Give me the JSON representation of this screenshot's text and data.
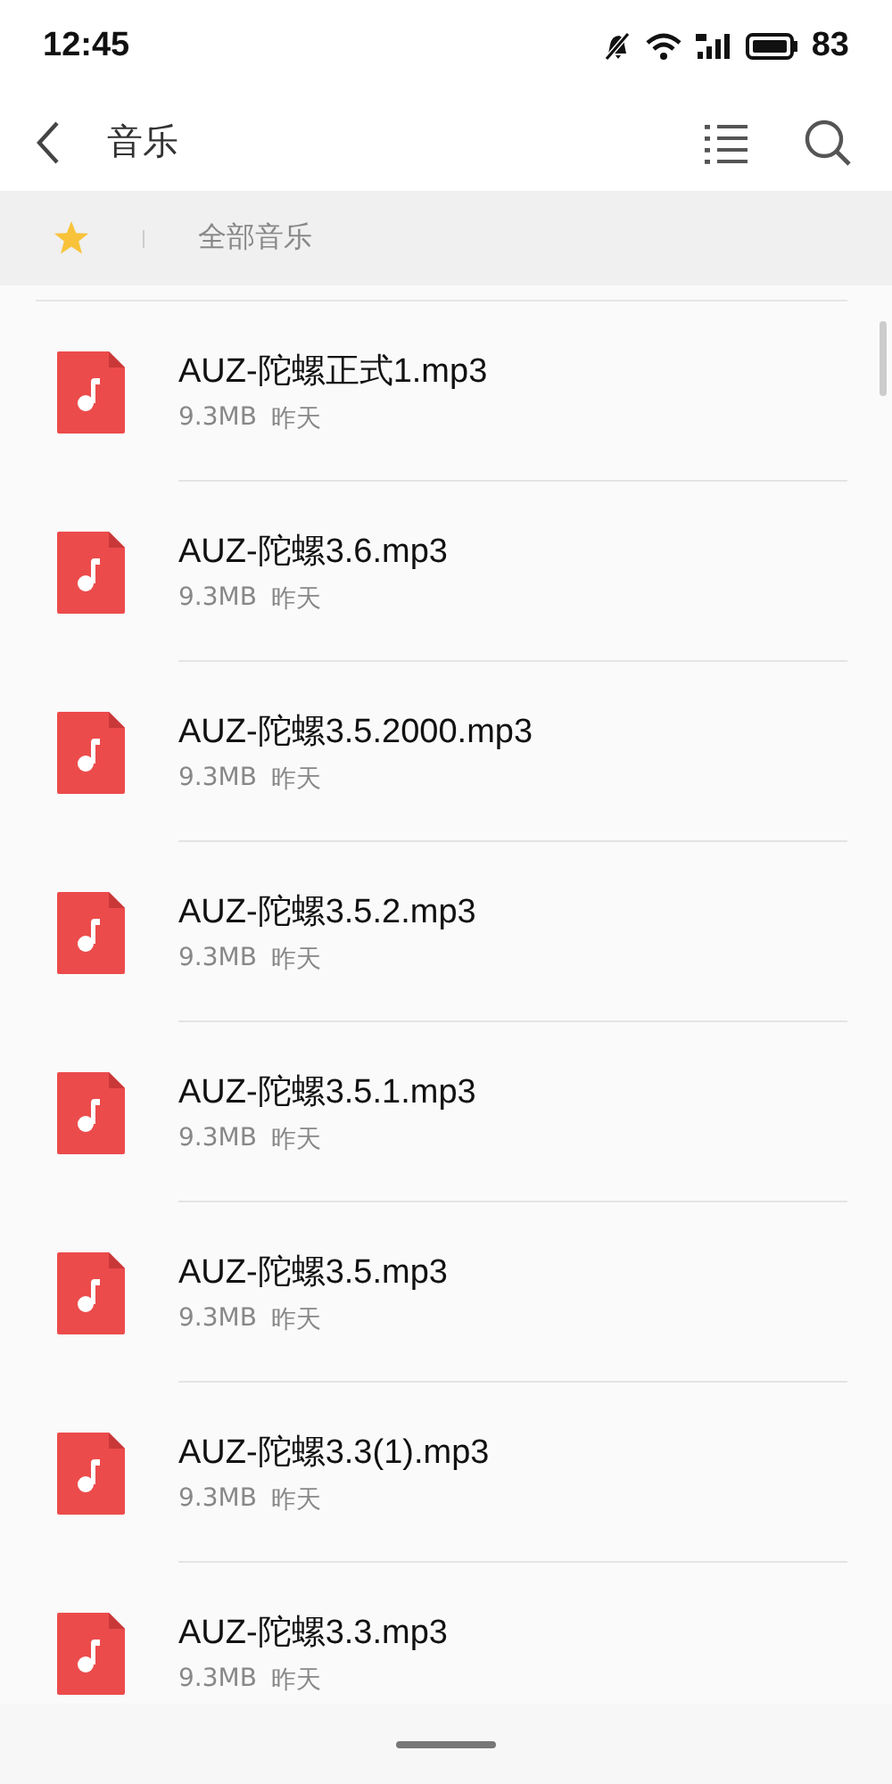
{
  "status_bar": {
    "time": "12:45",
    "battery": "83"
  },
  "app_bar": {
    "title": "音乐"
  },
  "breadcrumb": {
    "label": "全部音乐"
  },
  "files": [
    {
      "name": "AUZ-陀螺正式1.mp3",
      "size": "9.3MB",
      "date": "昨天"
    },
    {
      "name": "AUZ-陀螺3.6.mp3",
      "size": "9.3MB",
      "date": "昨天"
    },
    {
      "name": "AUZ-陀螺3.5.2000.mp3",
      "size": "9.3MB",
      "date": "昨天"
    },
    {
      "name": "AUZ-陀螺3.5.2.mp3",
      "size": "9.3MB",
      "date": "昨天"
    },
    {
      "name": "AUZ-陀螺3.5.1.mp3",
      "size": "9.3MB",
      "date": "昨天"
    },
    {
      "name": "AUZ-陀螺3.5.mp3",
      "size": "9.3MB",
      "date": "昨天"
    },
    {
      "name": "AUZ-陀螺3.3(1).mp3",
      "size": "9.3MB",
      "date": "昨天"
    },
    {
      "name": "AUZ-陀螺3.3.mp3",
      "size": "9.3MB",
      "date": "昨天"
    }
  ]
}
